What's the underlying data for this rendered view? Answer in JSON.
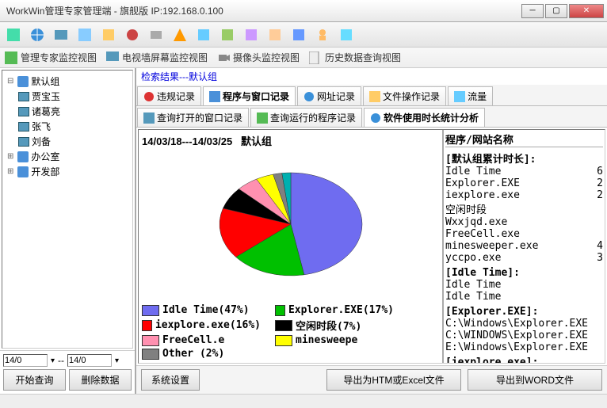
{
  "title": "WorkWin管理专家管理端 - 旗舰版 IP:192.168.0.100",
  "viewbar": {
    "v1": "管理专家监控视图",
    "v2": "电视墙屏幕监控视图",
    "v3": "摄像头监控视图",
    "v4": "历史数据查询视图"
  },
  "tree": {
    "root": "默认组",
    "users": [
      "贾宝玉",
      "诸葛亮",
      "张飞",
      "刘备"
    ],
    "groups": [
      "办公室",
      "开发部"
    ]
  },
  "dates": {
    "from": "14/0",
    "to": "14/0",
    "sep": "--"
  },
  "sidebar_btns": {
    "query": "开始查询",
    "delete": "删除数据"
  },
  "search_result": "检索结果---默认组",
  "tabs1": {
    "violation": "违规记录",
    "progwin": "程序与窗口记录",
    "url": "网址记录",
    "fileop": "文件操作记录",
    "traffic": "流量"
  },
  "tabs2": {
    "openwin": "查询打开的窗口记录",
    "runprog": "查询运行的程序记录",
    "usage": "软件使用时长统计分析"
  },
  "chart_title_date": "14/03/18---14/03/25",
  "chart_title_group": "默认组",
  "chart_data": {
    "type": "pie",
    "title": "14/03/18---14/03/25 默认组",
    "series": [
      {
        "name": "Idle Time",
        "pct": 47,
        "color": "#6f6cf0"
      },
      {
        "name": "Explorer.EXE",
        "pct": 17,
        "color": "#00c000"
      },
      {
        "name": "iexplore.exe",
        "pct": 16,
        "color": "#ff0000"
      },
      {
        "name": "空闲时段",
        "pct": 7,
        "color": "#000000"
      },
      {
        "name": "FreeCell.exe",
        "pct": 5,
        "color": "#ff90b0",
        "legend": "FreeCell.e"
      },
      {
        "name": "minesweeper.exe",
        "pct": 4,
        "color": "#ffff00",
        "legend": "minesweepe"
      },
      {
        "name": "Other",
        "pct": 2,
        "color": "#808080",
        "legend": "Other (2%)"
      },
      {
        "name": "_rest",
        "pct": 2,
        "color": "#00b0b0",
        "hidden": true
      }
    ]
  },
  "right_header": "程序/网站名称",
  "right_section1": "[默认组累计时长]:",
  "right_rows1": [
    {
      "n": "Idle Time",
      "v": "6"
    },
    {
      "n": "Explorer.EXE",
      "v": "2"
    },
    {
      "n": "iexplore.exe",
      "v": "2"
    },
    {
      "n": "空闲时段",
      "v": ""
    },
    {
      "n": "Wxxjqd.exe",
      "v": ""
    },
    {
      "n": "FreeCell.exe",
      "v": ""
    },
    {
      "n": "minesweeper.exe",
      "v": "4"
    },
    {
      "n": "yccpo.exe",
      "v": "3"
    }
  ],
  "right_section2": "[Idle Time]:",
  "right_rows2": [
    {
      "n": "Idle Time",
      "v": ""
    },
    {
      "n": "Idle Time",
      "v": ""
    }
  ],
  "right_section3": "[Explorer.EXE]:",
  "right_rows3": [
    {
      "n": "C:\\Windows\\Explorer.EXE",
      "v": ""
    },
    {
      "n": "C:\\WINDOWS\\Explorer.EXE",
      "v": ""
    },
    {
      "n": "E:\\Windows\\Explorer.EXE",
      "v": ""
    }
  ],
  "right_section4": "[iexplore.exe]:",
  "bottom": {
    "settings": "系统设置",
    "export_html": "导出为HTM或Excel文件",
    "export_word": "导出到WORD文件"
  }
}
